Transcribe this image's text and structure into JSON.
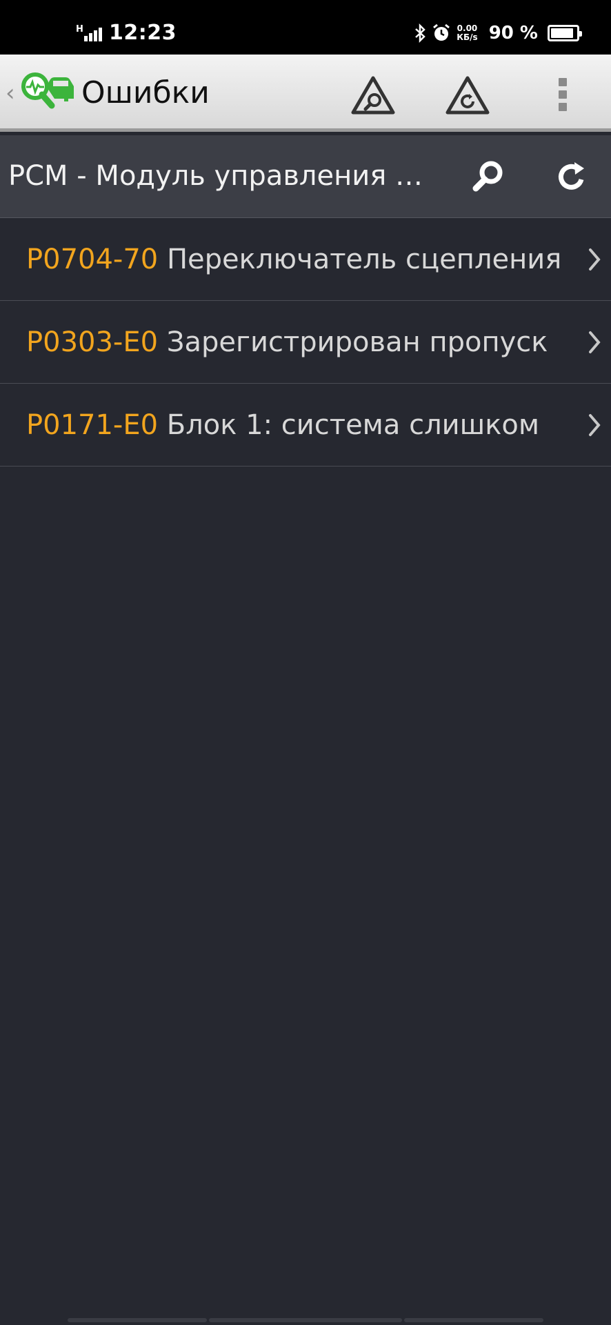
{
  "status_bar": {
    "time": "12:23",
    "network_type": "H",
    "net_speed_value": "0.00",
    "net_speed_unit": "КБ/s",
    "battery": "90 %",
    "battery_level": 0.9
  },
  "action_bar": {
    "title": "Ошибки",
    "icons": [
      "back-chevron-icon",
      "app-logo-icon",
      "car-search-warning-icon",
      "car-warning-refresh-icon",
      "overflow-menu-icon"
    ]
  },
  "module": {
    "title": "PCM - Модуль управления двигателем"
  },
  "errors": [
    {
      "code": "P0704-70",
      "description": "Переключатель сцепления"
    },
    {
      "code": "P0303-E0",
      "description": "Зарегистрирован пропуск"
    },
    {
      "code": "P0171-E0",
      "description": "Блок 1: система слишком"
    }
  ],
  "colors": {
    "error_code": "#f2a51e",
    "background": "#262830",
    "header": "#3c3e46",
    "logo_green": "#3cb43c"
  }
}
